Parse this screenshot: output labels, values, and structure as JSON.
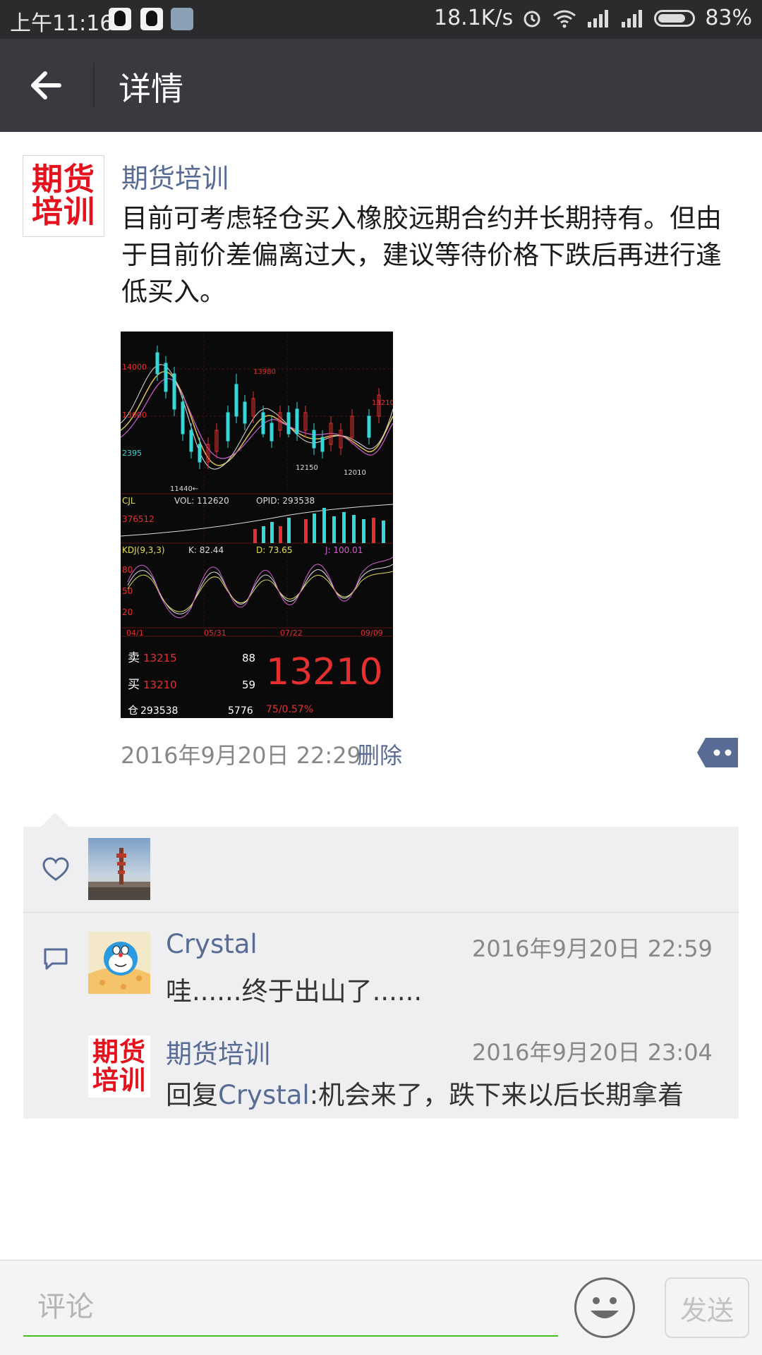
{
  "status_bar": {
    "time": "上午11:16",
    "net_speed": "18.1K/s",
    "battery": "83%",
    "battery_level": 0.83
  },
  "title_bar": {
    "title": "详情"
  },
  "post": {
    "author": "期货培训",
    "avatar_logo": [
      "期货",
      "培训"
    ],
    "text": "目前可考虑轻仓买入橡胶远期合约并长期持有。但由于目前价差偏离过大，建议等待价格下跌后再进行逢低买入。",
    "image": {
      "price_labels": [
        "14000",
        "13000",
        "2395",
        "11440←",
        "13980",
        "12150",
        "12010",
        "13210"
      ],
      "cjl_label": "CJL",
      "vol": "VOL: 112620",
      "opid": "OPID: 293538",
      "volume_value": "376512",
      "kdj_label": "KDJ(9,3,3)",
      "k": "K: 82.44",
      "d": "D: 73.65",
      "j": "J: 100.01",
      "kdj_ticks": [
        "80",
        "50",
        "20"
      ],
      "dates": [
        "04/1",
        "05/31",
        "07/22",
        "09/09"
      ],
      "sell_label": "卖",
      "sell_price": "13215",
      "sell_qty": "88",
      "buy_label": "买",
      "buy_price": "13210",
      "buy_qty": "59",
      "position_label": "仓",
      "position_value": "293538",
      "position_qty": "5776",
      "last_price": "13210",
      "change": "75/0.57%"
    },
    "timestamp": "2016年9月20日 22:29",
    "delete_label": "删除"
  },
  "comments": [
    {
      "author": "Crystal",
      "time": "2016年9月20日 22:59",
      "text": "哇......终于出山了......"
    },
    {
      "author": "期货培训",
      "time": "2016年9月20日 23:04",
      "reply_prefix": "回复",
      "reply_to": "Crystal",
      "text": ":机会来了，跌下来以后长期拿着"
    }
  ],
  "input_bar": {
    "placeholder": "评论",
    "send_label": "发送"
  }
}
